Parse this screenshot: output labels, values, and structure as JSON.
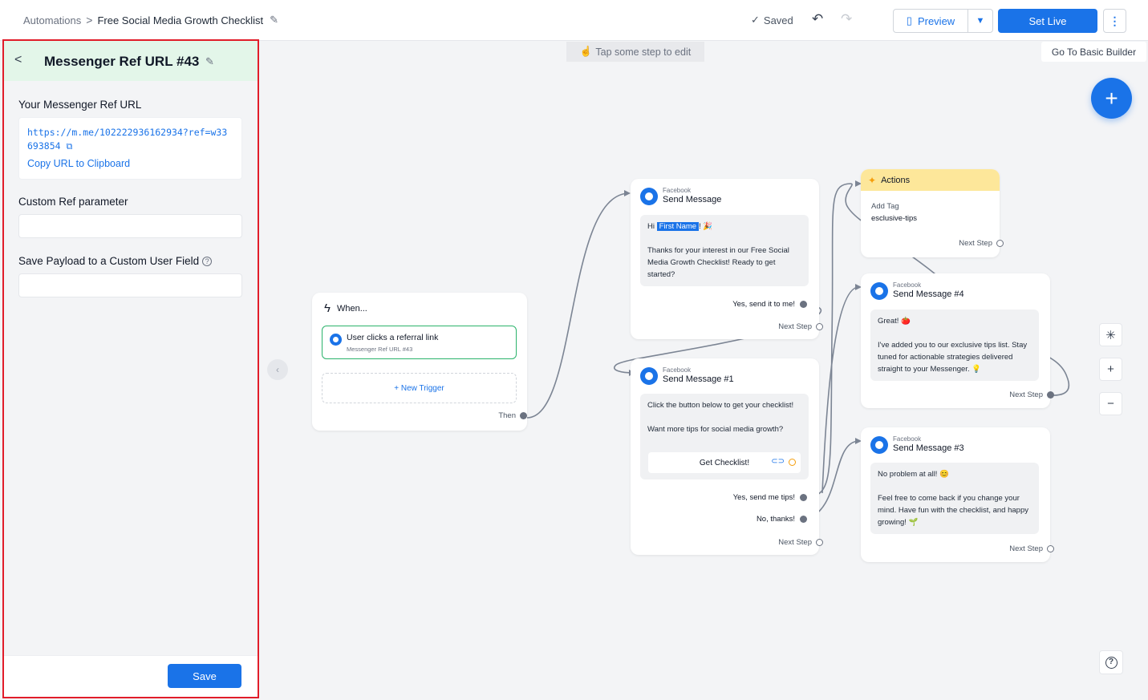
{
  "topbar": {
    "breadcrumb_root": "Automations",
    "breadcrumb_separator": ">",
    "breadcrumb_current": "Free Social Media Growth Checklist",
    "saved_label": "Saved",
    "preview_label": "Preview",
    "setlive_label": "Set Live"
  },
  "panel": {
    "title": "Messenger Ref URL #43",
    "ref_url_label": "Your Messenger Ref URL",
    "ref_url": "https://m.me/102222936162934?ref=w33693854",
    "copy_label": "Copy URL to Clipboard",
    "custom_ref_label": "Custom Ref parameter",
    "custom_ref_value": "",
    "payload_label": "Save Payload to a Custom User Field",
    "payload_value": "",
    "save_label": "Save"
  },
  "canvas": {
    "tap_banner": "Tap some step to edit",
    "basic_builder": "Go To Basic Builder",
    "trigger_card": {
      "when_label": "When...",
      "trigger_title": "User clicks a referral link",
      "trigger_sub": "Messenger Ref URL #43",
      "new_trigger": "+ New Trigger",
      "then_label": "Then"
    },
    "send_message": {
      "platform": "Facebook",
      "title": "Send Message",
      "greeting_prefix": "Hi",
      "first_name_tag": "First Name",
      "greeting_suffix": "! 🎉",
      "body": "Thanks for your interest in our Free Social Media Growth Checklist! Ready to get started?",
      "reply": "Yes, send it to me!",
      "next_step": "Next Step"
    },
    "send_message_1": {
      "platform": "Facebook",
      "title": "Send Message #1",
      "line1": "Click the button below to get your checklist!",
      "line2": "Want more tips for social media growth?",
      "button": "Get Checklist!",
      "reply1": "Yes, send me tips!",
      "reply2": "No, thanks!",
      "next_step": "Next Step"
    },
    "actions": {
      "title": "Actions",
      "action": "Add Tag",
      "tag": "esclusive-tips",
      "next_step": "Next Step"
    },
    "send_message_4": {
      "platform": "Facebook",
      "title": "Send Message #4",
      "line1": "Great! 🍅",
      "line2": "I've added you to our exclusive tips list. Stay tuned for actionable strategies delivered straight to your Messenger. 💡",
      "next_step": "Next Step"
    },
    "send_message_3": {
      "platform": "Facebook",
      "title": "Send Message #3",
      "line1": "No problem at all! 😊",
      "line2": "Feel free to come back if you change your mind. Have fun with the checklist, and happy growing! 🌱",
      "next_step": "Next Step"
    }
  },
  "colors": {
    "accent": "#1a73e8",
    "panel_highlight": "#e11d2a",
    "panel_header": "#e3f6e9",
    "actions_header": "#fde79a"
  }
}
